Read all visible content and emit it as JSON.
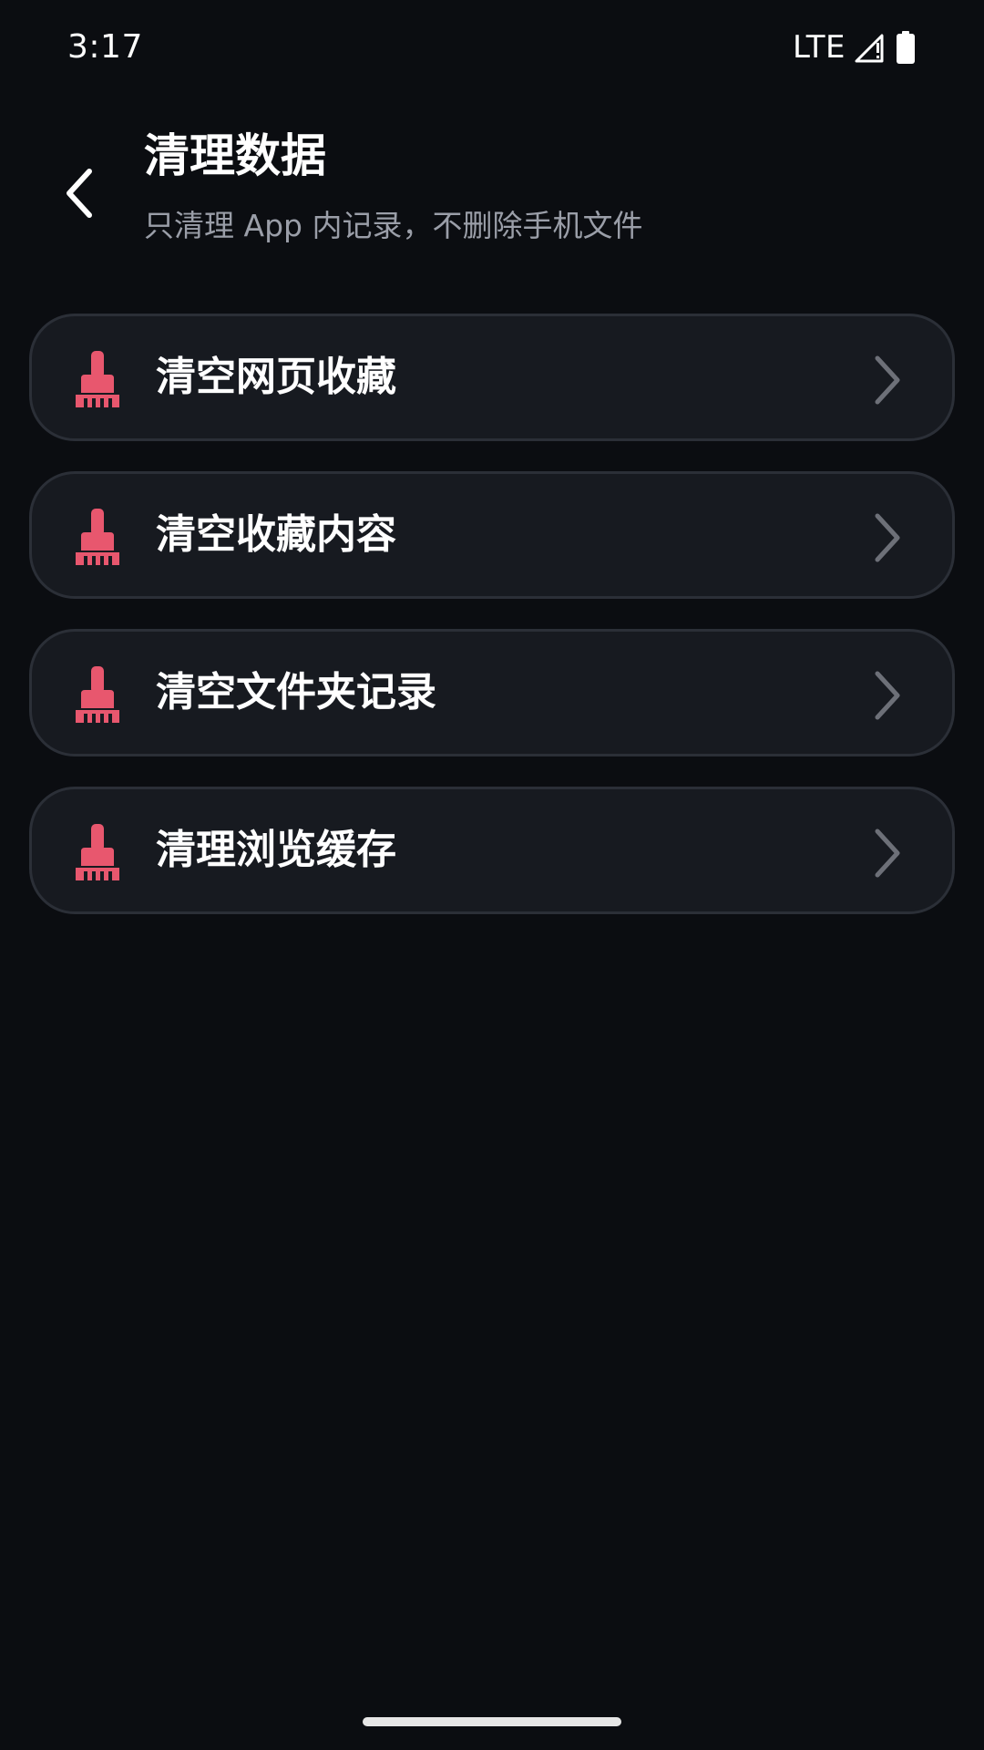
{
  "status_bar": {
    "time": "3:17",
    "network": "LTE",
    "signal_icon": "signal-icon",
    "battery_icon": "battery-icon"
  },
  "header": {
    "back_icon": "chevron-left-icon",
    "title": "清理数据",
    "subtitle": "只清理 App 内记录，不删除手机文件"
  },
  "items": [
    {
      "label": "清空网页收藏",
      "icon": "broom-icon"
    },
    {
      "label": "清空收藏内容",
      "icon": "broom-icon"
    },
    {
      "label": "清空文件夹记录",
      "icon": "broom-icon"
    },
    {
      "label": "清理浏览缓存",
      "icon": "broom-icon"
    }
  ],
  "colors": {
    "background": "#0b0d11",
    "card": "#171a20",
    "card_border": "#2b2f37",
    "accent_icon": "#e8576e",
    "subtitle": "#9a9ea8",
    "chevron": "#6d7078"
  }
}
